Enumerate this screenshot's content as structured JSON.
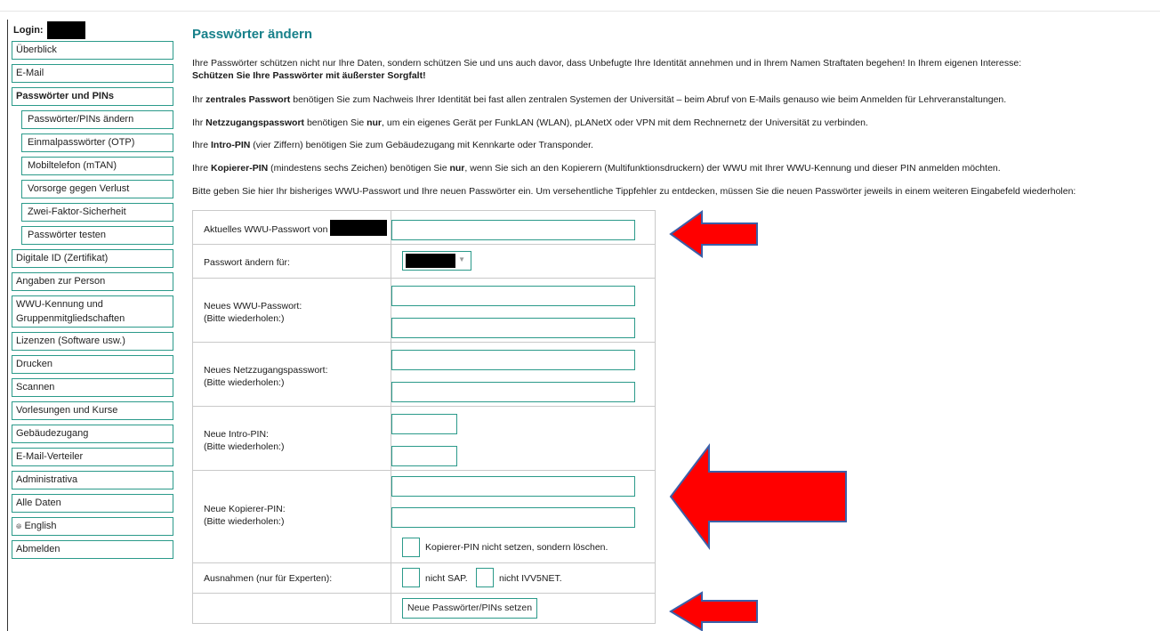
{
  "sidebar": {
    "login_label": "Login:",
    "items": [
      {
        "label": "Überblick"
      },
      {
        "label": "E-Mail"
      },
      {
        "label": "Passwörter und PINs"
      },
      {
        "label": "Passwörter/PINs ändern"
      },
      {
        "label": "Einmalpasswörter (OTP)"
      },
      {
        "label": "Mobiltelefon (mTAN)"
      },
      {
        "label": "Vorsorge gegen Verlust"
      },
      {
        "label": "Zwei-Faktor-Sicherheit"
      },
      {
        "label": "Passwörter testen"
      },
      {
        "label": "Digitale ID (Zertifikat)"
      },
      {
        "label": "Angaben zur Person"
      },
      {
        "label": "WWU-Kennung und Gruppenmitgliedschaften"
      },
      {
        "label": "Lizenzen (Software usw.)"
      },
      {
        "label": "Drucken"
      },
      {
        "label": "Scannen"
      },
      {
        "label": "Vorlesungen und Kurse"
      },
      {
        "label": "Gebäudezugang"
      },
      {
        "label": "E-Mail-Verteiler"
      },
      {
        "label": "Administrativa"
      },
      {
        "label": "Alle Daten"
      },
      {
        "label": "English",
        "icon": "language-icon"
      },
      {
        "label": "Abmelden"
      }
    ]
  },
  "main": {
    "title": "Passwörter ändern",
    "intro_1": "Ihre Passwörter schützen nicht nur Ihre Daten, sondern schützen Sie und uns auch davor, dass Unbefugte Ihre Identität annehmen und in Ihrem Namen Straftaten begehen! In Ihrem eigenen Interesse:",
    "intro_2": "Schützen Sie Ihre Passwörter mit äußerster Sorgfalt!",
    "p_central_a": "Ihr ",
    "p_central_b": "zentrales Passwort",
    "p_central_c": " benötigen Sie zum Nachweis Ihrer Identität bei fast allen zentralen Systemen der Universität – beim Abruf von E-Mails genauso wie beim Anmelden für Lehrveranstaltungen.",
    "p_net_a": "Ihr ",
    "p_net_b": "Netzzugangspasswort",
    "p_net_c": " benötigen Sie ",
    "p_net_d": "nur",
    "p_net_e": ", um ein eigenes Gerät per FunkLAN (WLAN), pLANetX oder VPN mit dem Rechnernetz der Universität zu verbinden.",
    "p_intro_a": "Ihre ",
    "p_intro_b": "Intro-PIN",
    "p_intro_c": " (vier Ziffern) benötigen Sie zum Gebäudezugang mit Kennkarte oder Transponder.",
    "p_copy_a": "Ihre ",
    "p_copy_b": "Kopierer-PIN",
    "p_copy_c": " (mindestens sechs Zeichen) benötigen Sie ",
    "p_copy_d": "nur",
    "p_copy_e": ", wenn Sie sich an den Kopierern (Multifunktionsdruckern) der WWU mit Ihrer WWU-Kennung und dieser PIN anmelden möchten.",
    "p_instr": "Bitte geben Sie hier Ihr bisheriges WWU-Passwort und Ihre neuen Passwörter ein. Um versehentliche Tippfehler zu entdecken, müssen Sie die neuen Passwörter jeweils in einem weiteren Eingabefeld wiederholen:"
  },
  "form": {
    "current_label": "Aktuelles WWU-Passwort von",
    "change_for_label": "Passwort ändern für:",
    "new_wwu_label_1": "Neues WWU-Passwort:",
    "new_wwu_label_2": "(Bitte wiederholen:)",
    "new_net_label_1": "Neues Netzzugangspasswort:",
    "new_net_label_2": "(Bitte wiederholen:)",
    "intro_pin_label_1": "Neue Intro-PIN:",
    "intro_pin_label_2": "(Bitte wiederholen:)",
    "copy_pin_label_1": "Neue Kopierer-PIN:",
    "copy_pin_label_2": "(Bitte wiederholen:)",
    "copy_pin_delete_label": "Kopierer-PIN nicht setzen, sondern löschen.",
    "exceptions_label": "Ausnahmen (nur für Experten):",
    "no_sap_label": "nicht SAP.",
    "no_ivv_label": "nicht IVV5NET.",
    "submit_label": "Neue Passwörter/PINs setzen"
  },
  "colors": {
    "accent": "#2b9a8a",
    "title": "#17808a",
    "arrow_fill": "#ff0000",
    "arrow_stroke": "#3b5fa8"
  }
}
